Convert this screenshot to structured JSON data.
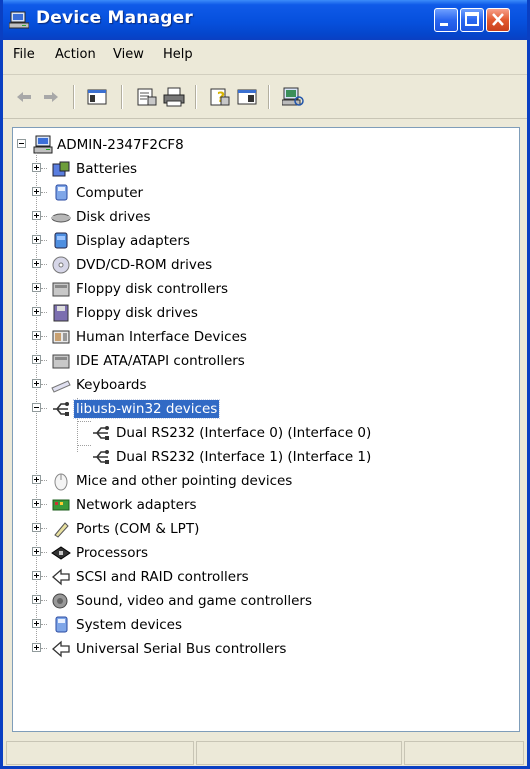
{
  "window": {
    "title": "Device Manager",
    "colors": {
      "title_bar": "#0650dd",
      "selection": "#316ac5",
      "chrome": "#ece9d8"
    }
  },
  "menu": {
    "items": [
      "File",
      "Action",
      "View",
      "Help"
    ]
  },
  "toolbar": {
    "icons": [
      "back-arrow-icon",
      "forward-arrow-icon",
      "show-hide-console-tree-icon",
      "properties-icon",
      "print-icon",
      "help-icon",
      "show-hide-action-pane-icon",
      "scan-hardware-icon"
    ]
  },
  "tree": {
    "root": "ADMIN-2347F2CF8",
    "nodes": [
      {
        "label": "Batteries",
        "icon": "battery-icon"
      },
      {
        "label": "Computer",
        "icon": "computer-icon"
      },
      {
        "label": "Disk drives",
        "icon": "disk-drive-icon"
      },
      {
        "label": "Display adapters",
        "icon": "display-adapter-icon"
      },
      {
        "label": "DVD/CD-ROM drives",
        "icon": "dvd-drive-icon"
      },
      {
        "label": "Floppy disk controllers",
        "icon": "floppy-controller-icon"
      },
      {
        "label": "Floppy disk drives",
        "icon": "floppy-drive-icon"
      },
      {
        "label": "Human Interface Devices",
        "icon": "hid-icon"
      },
      {
        "label": "IDE ATA/ATAPI controllers",
        "icon": "ide-controller-icon"
      },
      {
        "label": "Keyboards",
        "icon": "keyboard-icon"
      },
      {
        "label": "libusb-win32 devices",
        "icon": "usb-icon",
        "expanded": true,
        "selected": true,
        "children": [
          {
            "label": "Dual RS232 (Interface 0) (Interface 0)",
            "icon": "usb-device-icon"
          },
          {
            "label": "Dual RS232 (Interface 1) (Interface 1)",
            "icon": "usb-device-icon"
          }
        ]
      },
      {
        "label": "Mice and other pointing devices",
        "icon": "mouse-icon"
      },
      {
        "label": "Network adapters",
        "icon": "network-adapter-icon"
      },
      {
        "label": "Ports (COM & LPT)",
        "icon": "port-icon"
      },
      {
        "label": "Processors",
        "icon": "processor-icon"
      },
      {
        "label": "SCSI and RAID controllers",
        "icon": "scsi-icon"
      },
      {
        "label": "Sound, video and game controllers",
        "icon": "sound-icon"
      },
      {
        "label": "System devices",
        "icon": "system-devices-icon"
      },
      {
        "label": "Universal Serial Bus controllers",
        "icon": "usb-controller-icon"
      }
    ]
  }
}
